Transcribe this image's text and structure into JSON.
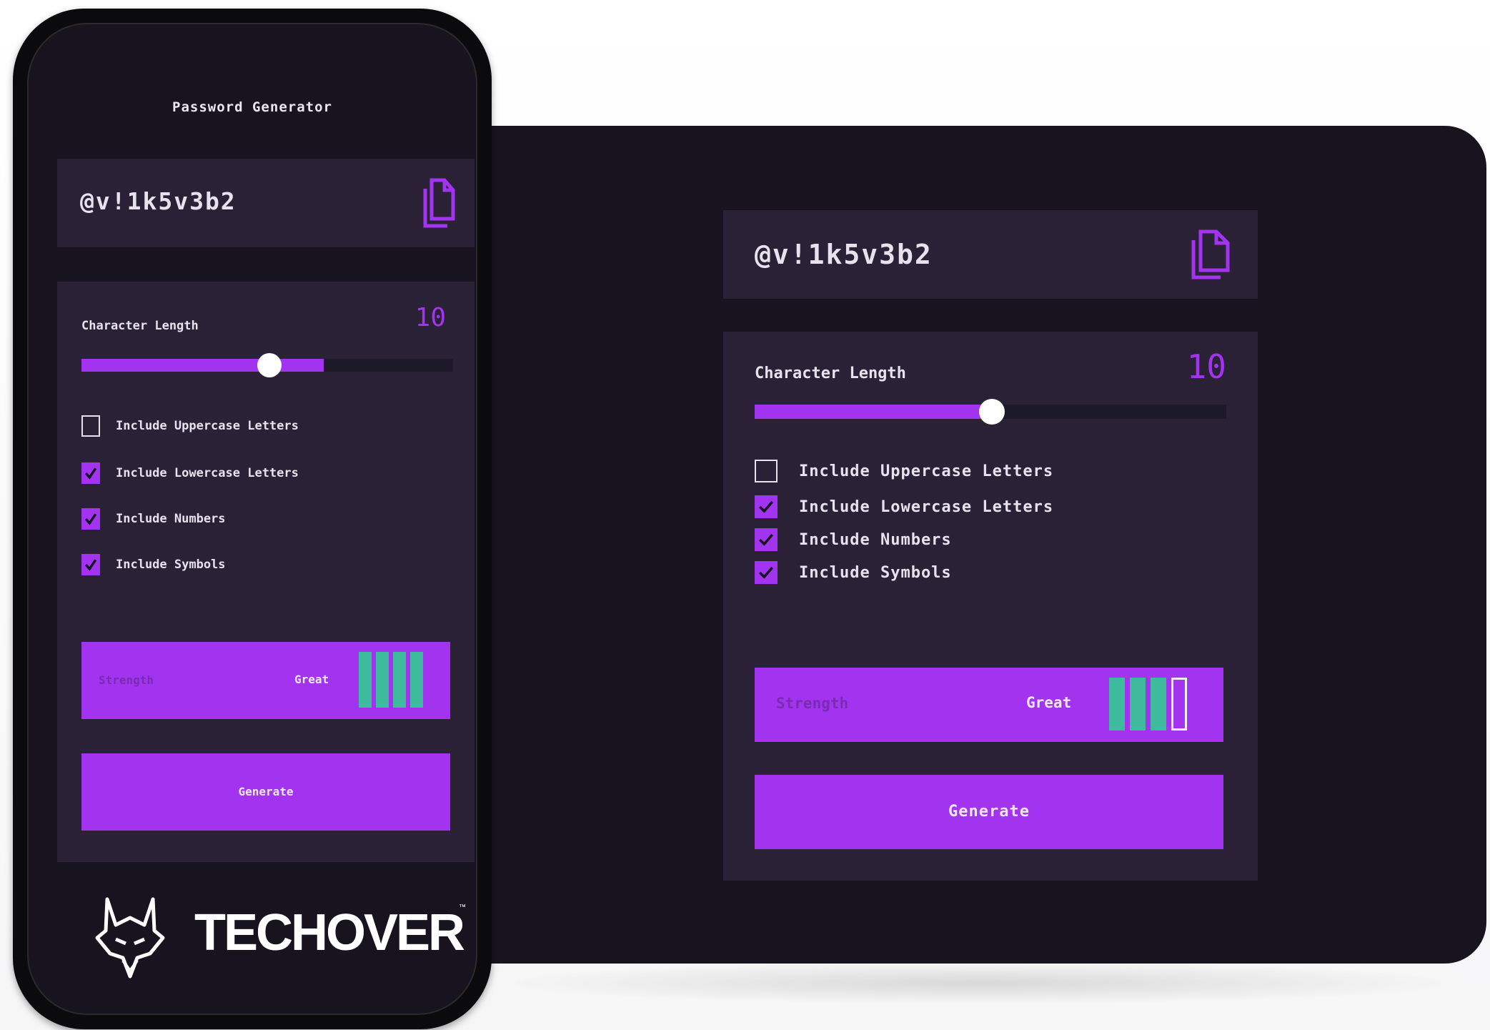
{
  "colors": {
    "accent": "#a234ef",
    "panel": "#2a2137",
    "background_dark": "#18141f",
    "strength_bar": "#3ebb9c",
    "text": "#e6e3ec"
  },
  "mobile": {
    "title": "Password Generator",
    "password": "@v!1k5v3b2",
    "copy_icon": "copy-icon",
    "length": {
      "label": "Character Length",
      "value": "10",
      "slider_fraction": 0.5
    },
    "options": [
      {
        "label": "Include Uppercase Letters",
        "checked": false
      },
      {
        "label": "Include Lowercase Letters",
        "checked": true
      },
      {
        "label": "Include Numbers",
        "checked": true
      },
      {
        "label": "Include Symbols",
        "checked": true
      }
    ],
    "strength": {
      "label": "Strength",
      "value": "Great",
      "bars_filled": 4,
      "bars_total": 4
    },
    "generate_label": "Generate",
    "logo_text": "TECHOVER",
    "logo_tm": "™"
  },
  "desktop": {
    "password": "@v!1k5v3b2",
    "copy_icon": "copy-icon",
    "length": {
      "label": "Character Length",
      "value": "10",
      "slider_fraction": 0.5
    },
    "options": [
      {
        "label": "Include Uppercase Letters",
        "checked": false
      },
      {
        "label": "Include Lowercase Letters",
        "checked": true
      },
      {
        "label": "Include Numbers",
        "checked": true
      },
      {
        "label": "Include Symbols",
        "checked": true
      }
    ],
    "strength": {
      "label": "Strength",
      "value": "Great",
      "bars_filled": 3,
      "bars_total": 4
    },
    "generate_label": "Generate"
  }
}
